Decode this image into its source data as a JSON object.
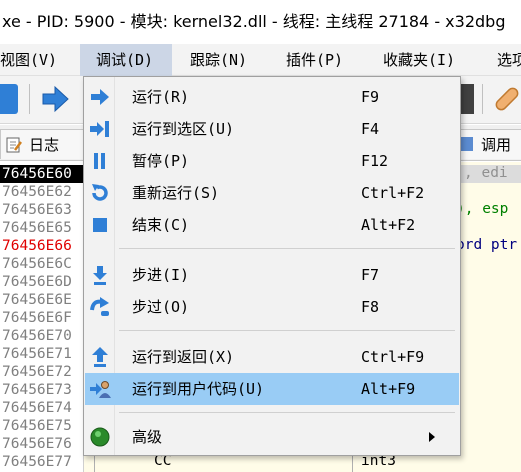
{
  "window": {
    "title": "xe - PID: 5900 - 模块: kernel32.dll - 线程: 主线程 27184 - x32dbg"
  },
  "menubar": {
    "items": [
      {
        "label": "视图(V)"
      },
      {
        "label": "调试(D)"
      },
      {
        "label": "跟踪(N)"
      },
      {
        "label": "插件(P)"
      },
      {
        "label": "收藏夹(I)"
      },
      {
        "label": "选项"
      }
    ]
  },
  "tabs": {
    "log": "日志",
    "call": "调用"
  },
  "addresses": [
    {
      "text": "76456E60",
      "state": "selected"
    },
    {
      "text": "76456E62",
      "state": "normal"
    },
    {
      "text": "76456E63",
      "state": "normal"
    },
    {
      "text": "76456E65",
      "state": "normal"
    },
    {
      "text": "76456E66",
      "state": "red"
    },
    {
      "text": "76456E6C",
      "state": "normal"
    },
    {
      "text": "76456E6D",
      "state": "normal"
    },
    {
      "text": "76456E6E",
      "state": "normal"
    },
    {
      "text": "76456E6F",
      "state": "normal"
    },
    {
      "text": "76456E70",
      "state": "normal"
    },
    {
      "text": "76456E71",
      "state": "normal"
    },
    {
      "text": "76456E72",
      "state": "normal"
    },
    {
      "text": "76456E73",
      "state": "normal"
    },
    {
      "text": "76456E74",
      "state": "normal"
    },
    {
      "text": "76456E75",
      "state": "normal"
    },
    {
      "text": "76456E76",
      "state": "normal"
    },
    {
      "text": "76456E77",
      "state": "normal"
    }
  ],
  "disasm_visible": {
    "row1": ", edi",
    "row3": "), esp",
    "row5": "ord ptr",
    "bytes_last": "CC",
    "instr_last": "int3"
  },
  "context_menu": {
    "items": [
      {
        "label": "运行(R)",
        "shortcut": "F9",
        "icon": "run-arrow-icon"
      },
      {
        "label": "运行到选区(U)",
        "shortcut": "F4",
        "icon": "run-to-selection-icon"
      },
      {
        "label": "暂停(P)",
        "shortcut": "F12",
        "icon": "pause-icon"
      },
      {
        "label": "重新运行(S)",
        "shortcut": "Ctrl+F2",
        "icon": "restart-icon"
      },
      {
        "label": "结束(C)",
        "shortcut": "Alt+F2",
        "icon": "stop-icon"
      },
      {
        "label": "步进(I)",
        "shortcut": "F7",
        "icon": "step-into-icon"
      },
      {
        "label": "步过(O)",
        "shortcut": "F8",
        "icon": "step-over-icon"
      },
      {
        "label": "运行到返回(X)",
        "shortcut": "Ctrl+F9",
        "icon": "execute-till-return-icon"
      },
      {
        "label": "运行到用户代码(U)",
        "shortcut": "Alt+F9",
        "icon": "run-to-user-code-icon"
      },
      {
        "label": "高级",
        "shortcut": "",
        "icon": "advanced-green-icon"
      }
    ],
    "highlighted_index": 8
  },
  "colors": {
    "menu_highlight": "#99ccf5",
    "addr_red": "#e00000",
    "icon_blue": "#2f7fd6"
  }
}
